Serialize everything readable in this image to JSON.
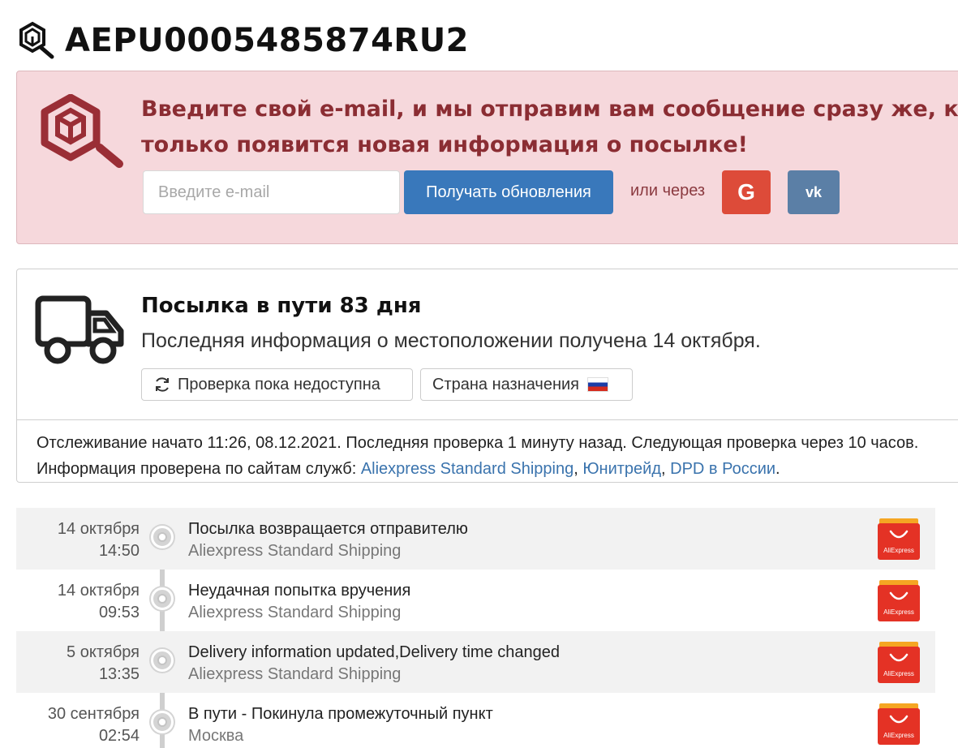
{
  "header": {
    "tracking_number": "AEPU0005485874RU2",
    "icon": "package-search-icon"
  },
  "subscribe": {
    "message": "Введите свой e-mail, и мы отправим вам сообщение сразу же, как только появится новая информация о посылке!",
    "email_placeholder": "Введите e-mail",
    "get_updates_label": "Получать обновления",
    "or_via_label": "или через",
    "google_label": "G",
    "vk_label": "vk",
    "colors": {
      "background": "#f6d8dc",
      "text": "#8b2d33",
      "primary": "#3978bb",
      "google": "#dd4b39",
      "vk": "#5b7fa6"
    }
  },
  "status": {
    "title": "Посылка в пути 83 дня",
    "subtitle": "Последняя информация о местоположении получена 14 октября.",
    "check_button": "Проверка пока недоступна",
    "destination_button": "Страна назначения",
    "destination_flag": "russia-flag",
    "tracking_info_prefix": "Отслеживание начато 11:26, 08.12.2021. Последняя проверка 1 минуту назад. Следующая проверка через 10 часов.",
    "checked_prefix": "Информация проверена по сайтам служб:",
    "services": [
      "Aliexpress Standard Shipping",
      "Юнитрейд",
      "DPD в России"
    ],
    "sep1": ", ",
    "sep2": ", ",
    "end": "."
  },
  "events": [
    {
      "date": "14 октября",
      "time": "14:50",
      "title": "Посылка возвращается отправителю",
      "service": "Aliexpress Standard Shipping",
      "logo": "AliExpress"
    },
    {
      "date": "14 октября",
      "time": "09:53",
      "title": "Неудачная попытка вручения",
      "service": "Aliexpress Standard Shipping",
      "logo": "AliExpress"
    },
    {
      "date": "5 октября",
      "time": "13:35",
      "title": "Delivery information updated,Delivery time changed",
      "service": "Aliexpress Standard Shipping",
      "logo": "AliExpress"
    },
    {
      "date": "30 сентября",
      "time": "02:54",
      "title": "В пути - Покинула промежуточный пункт",
      "service": "Москва",
      "logo": "AliExpress"
    }
  ]
}
